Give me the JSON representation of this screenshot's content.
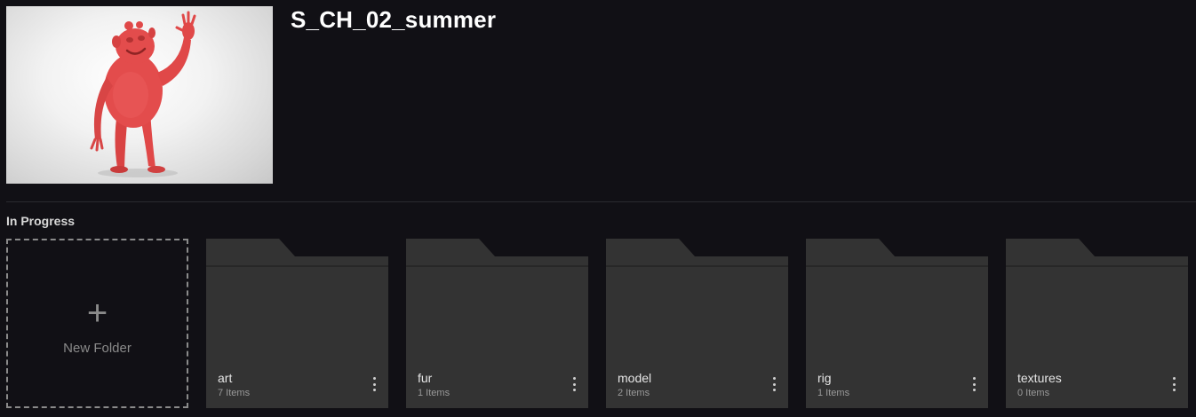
{
  "asset": {
    "title": "S_CH_02_summer",
    "thumbnail_icon": "red-character-preview-image"
  },
  "section": {
    "label": "In Progress"
  },
  "new_folder": {
    "plus": "+",
    "label": "New Folder"
  },
  "folders": [
    {
      "name": "art",
      "count": "7 Items"
    },
    {
      "name": "fur",
      "count": "1 Items"
    },
    {
      "name": "model",
      "count": "2 Items"
    },
    {
      "name": "rig",
      "count": "1 Items"
    },
    {
      "name": "textures",
      "count": "0 Items"
    }
  ],
  "colors": {
    "background": "#111015",
    "folder": "#333333",
    "character": "#e24a4a"
  }
}
